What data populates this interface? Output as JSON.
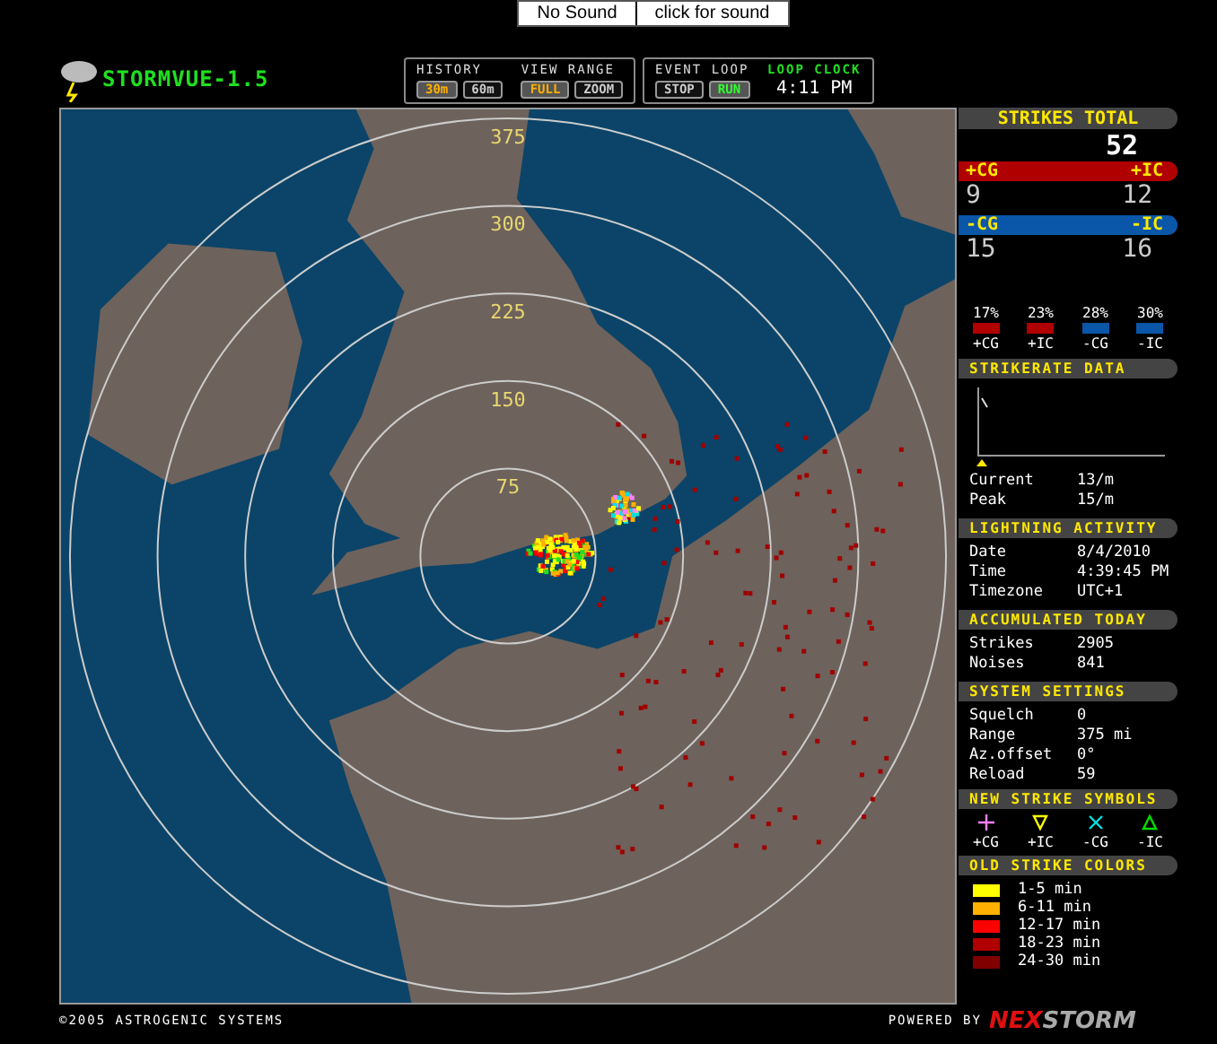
{
  "sound_bar": {
    "left": "No Sound",
    "right": "click for sound"
  },
  "logo": "STORMVUE-1.5",
  "history": {
    "label": "HISTORY",
    "options": [
      {
        "label": "30m",
        "selected": true
      },
      {
        "label": "60m",
        "selected": false
      }
    ]
  },
  "view_range": {
    "label": "VIEW RANGE",
    "options": [
      {
        "label": "FULL",
        "selected": true
      },
      {
        "label": "ZOOM",
        "selected": false
      }
    ]
  },
  "event_loop": {
    "label": "EVENT LOOP",
    "options": [
      {
        "label": "STOP",
        "selected": false
      },
      {
        "label": "RUN",
        "selected": true
      }
    ]
  },
  "loop_clock": {
    "label": "LOOP CLOCK",
    "time": "4:11 PM"
  },
  "map": {
    "range_labels": [
      "375",
      "300",
      "225",
      "150",
      "75"
    ]
  },
  "strikes_total": {
    "title": "STRIKES TOTAL",
    "value": "52"
  },
  "counts": [
    {
      "left_label": "+CG",
      "right_label": "+IC",
      "left_value": "9",
      "right_value": "12",
      "color": "#b00000"
    },
    {
      "left_label": "-CG",
      "right_label": "-IC",
      "left_value": "15",
      "right_value": "16",
      "color": "#0a56a8"
    }
  ],
  "percentages": [
    {
      "value": "17%",
      "label": "+CG",
      "color": "#b00000"
    },
    {
      "value": "23%",
      "label": "+IC",
      "color": "#b00000"
    },
    {
      "value": "28%",
      "label": "-CG",
      "color": "#0a56a8"
    },
    {
      "value": "30%",
      "label": "-IC",
      "color": "#0a56a8"
    }
  ],
  "strikerate": {
    "title": "STRIKERATE DATA",
    "rows": [
      {
        "label": "Current",
        "value": "13/m"
      },
      {
        "label": "Peak",
        "value": "15/m"
      }
    ]
  },
  "sections": [
    {
      "title": "LIGHTNING ACTIVITY",
      "rows": [
        {
          "label": "Date",
          "value": "8/4/2010"
        },
        {
          "label": "Time",
          "value": "4:39:45 PM"
        },
        {
          "label": "Timezone",
          "value": "UTC+1"
        }
      ]
    },
    {
      "title": "ACCUMULATED TODAY",
      "rows": [
        {
          "label": "Strikes",
          "value": "2905"
        },
        {
          "label": "Noises",
          "value": "841"
        }
      ]
    },
    {
      "title": "SYSTEM SETTINGS",
      "rows": [
        {
          "label": "Squelch",
          "value": "0"
        },
        {
          "label": "Range",
          "value": "375 mi"
        },
        {
          "label": "Az.offset",
          "value": "0°"
        },
        {
          "label": "Reload",
          "value": "59"
        }
      ]
    }
  ],
  "new_strike_symbols": {
    "title": "NEW STRIKE SYMBOLS",
    "items": [
      {
        "kind": "plus",
        "label": "+CG",
        "color": "#ff80ff"
      },
      {
        "kind": "triangle-down",
        "label": "+IC",
        "color": "#ffff00"
      },
      {
        "kind": "cross",
        "label": "-CG",
        "color": "#00e0e0"
      },
      {
        "kind": "triangle-up",
        "label": "-IC",
        "color": "#00e000"
      }
    ]
  },
  "old_strike_colors": {
    "title": "OLD STRIKE COLORS",
    "items": [
      {
        "label": "1-5 min",
        "color": "#ffff00"
      },
      {
        "label": "6-11 min",
        "color": "#ffb000"
      },
      {
        "label": "12-17 min",
        "color": "#ff0000"
      },
      {
        "label": "18-23 min",
        "color": "#b00000"
      },
      {
        "label": "24-30 min",
        "color": "#800000"
      }
    ]
  },
  "footer": {
    "copyright": "©2005 ASTROGENIC SYSTEMS",
    "powered_by": "POWERED BY",
    "brand": [
      "NEX",
      "STORM"
    ]
  }
}
